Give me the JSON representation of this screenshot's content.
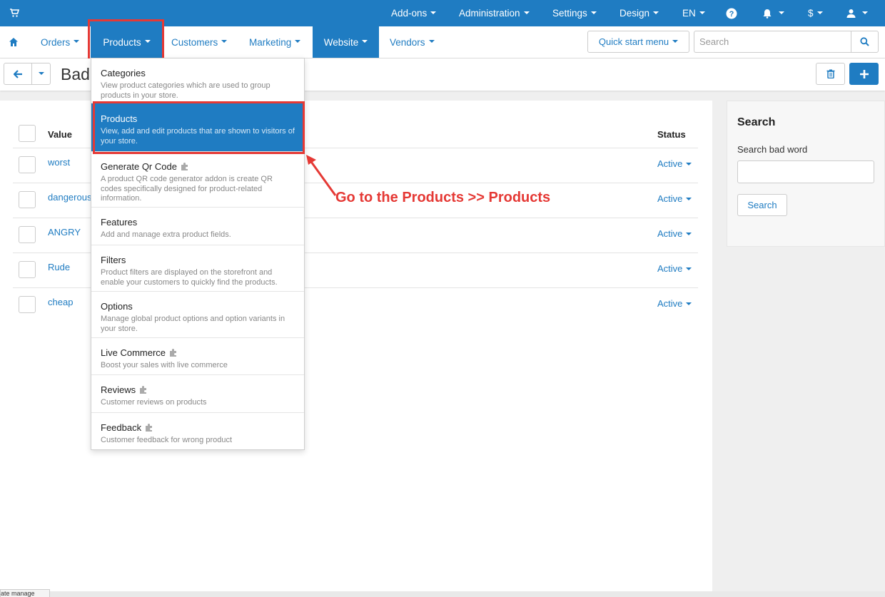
{
  "topbar": {
    "menus": [
      {
        "label": "Add-ons"
      },
      {
        "label": "Administration"
      },
      {
        "label": "Settings"
      },
      {
        "label": "Design"
      },
      {
        "label": "EN"
      },
      {
        "label": "$"
      }
    ]
  },
  "nav": {
    "items": [
      {
        "label": "Orders"
      },
      {
        "label": "Products"
      },
      {
        "label": "Customers"
      },
      {
        "label": "Marketing"
      },
      {
        "label": "Website"
      },
      {
        "label": "Vendors"
      }
    ],
    "quick_start": "Quick start menu",
    "search_placeholder": "Search"
  },
  "page": {
    "title": "Bad"
  },
  "table": {
    "col_value": "Value",
    "col_status": "Status",
    "rows": [
      {
        "value": "worst",
        "status": "Active"
      },
      {
        "value": "dangerous",
        "status": "Active"
      },
      {
        "value": "ANGRY",
        "status": "Active"
      },
      {
        "value": "Rude",
        "status": "Active"
      },
      {
        "value": "cheap",
        "status": "Active"
      }
    ]
  },
  "sidebar": {
    "title": "Search",
    "label": "Search bad word",
    "button": "Search"
  },
  "dropdown": {
    "items": [
      {
        "title": "Categories",
        "desc": "View product categories which are used to group products in your store.",
        "addon": false
      },
      {
        "title": "Products",
        "desc": "View, add and edit products that are shown to visitors of your store.",
        "addon": false,
        "selected": true
      },
      {
        "title": "Generate Qr Code",
        "desc": "A product QR code generator addon is create QR codes specifically designed for product-related information.",
        "addon": true
      },
      {
        "title": "Features",
        "desc": "Add and manage extra product fields.",
        "addon": false
      },
      {
        "title": "Filters",
        "desc": "Product filters are displayed on the storefront and enable your customers to quickly find the products.",
        "addon": false
      },
      {
        "title": "Options",
        "desc": "Manage global product options and option variants in your store.",
        "addon": false
      },
      {
        "title": "Live Commerce",
        "desc": "Boost your sales with live commerce",
        "addon": true
      },
      {
        "title": "Reviews",
        "desc": "Customer reviews on products",
        "addon": true
      },
      {
        "title": "Feedback",
        "desc": "Customer feedback for wrong product",
        "addon": true
      }
    ]
  },
  "annotation": {
    "text": "Go to the Products >> Products"
  },
  "bottom_tab": "ate manage",
  "colors": {
    "primary": "#1f7cc2",
    "highlight": "#e53935"
  }
}
